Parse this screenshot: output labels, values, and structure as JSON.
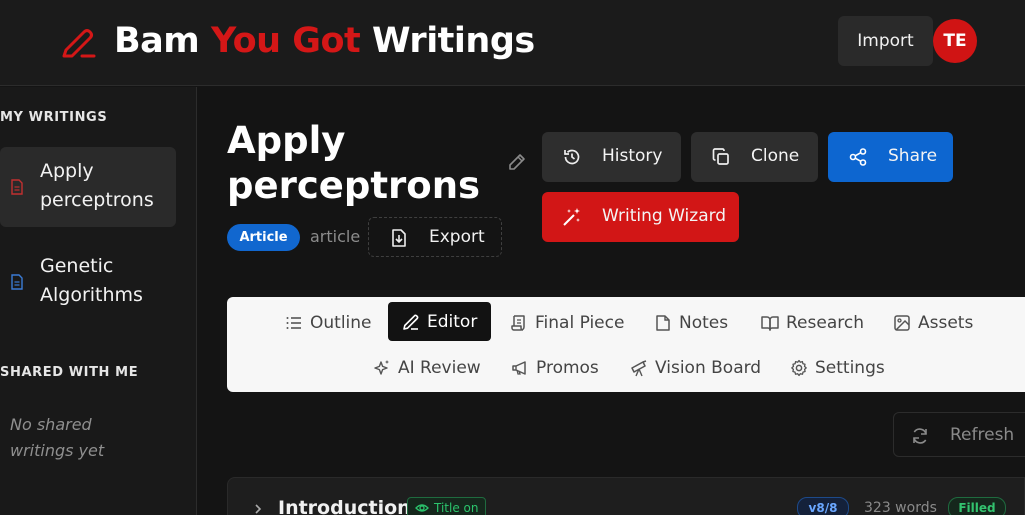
{
  "header": {
    "brand_part1": "Bam",
    "brand_part2": "You Got",
    "brand_part3": "Writings",
    "import_label": "Import",
    "avatar_initials": "TE",
    "accent_color": "#d41717"
  },
  "sidebar": {
    "my_writings_label": "MY WRITINGS",
    "items": [
      {
        "label": "Apply perceptrons",
        "icon": "document-icon",
        "active": true
      },
      {
        "label": "Genetic Algorithms",
        "icon": "document-icon",
        "active": false
      }
    ],
    "shared_label": "SHARED WITH ME",
    "shared_empty": "No shared writings yet"
  },
  "document": {
    "title": "Apply perceptrons",
    "type_badge": "Article",
    "type_text": "article",
    "export_label": "Export"
  },
  "actions": {
    "history": "History",
    "clone": "Clone",
    "share": "Share",
    "wizard": "Writing Wizard"
  },
  "tabs": [
    {
      "label": "Outline",
      "icon": "list-icon"
    },
    {
      "label": "Editor",
      "icon": "pencil-icon",
      "active": true
    },
    {
      "label": "Final Piece",
      "icon": "scroll-icon"
    },
    {
      "label": "Notes",
      "icon": "note-icon"
    },
    {
      "label": "Research",
      "icon": "book-icon"
    },
    {
      "label": "Assets",
      "icon": "image-icon"
    },
    {
      "label": "AI Review",
      "icon": "sparkles-icon"
    },
    {
      "label": "Promos",
      "icon": "megaphone-icon"
    },
    {
      "label": "Vision Board",
      "icon": "telescope-icon"
    },
    {
      "label": "Settings",
      "icon": "gear-icon"
    }
  ],
  "refresh_label": "Refresh",
  "sections": [
    {
      "title": "Introduction",
      "title_badge": "Title on",
      "version": "v8/8",
      "words": "323 words",
      "status": "Filled"
    }
  ]
}
